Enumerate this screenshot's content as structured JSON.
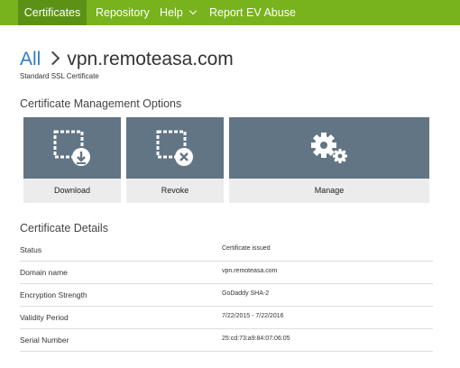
{
  "nav": {
    "items": [
      {
        "label": "Certificates",
        "active": true
      },
      {
        "label": "Repository",
        "active": false
      },
      {
        "label": "Help",
        "active": false,
        "icon": "chevron-down-icon"
      },
      {
        "label": "Report EV Abuse",
        "active": false
      }
    ]
  },
  "colors": {
    "nav_bg": "#78b31d",
    "nav_active_bg": "#5b9216",
    "link": "#2f7fc8",
    "tile_bg": "#627584",
    "tile_label_bg": "#ececec"
  },
  "header": {
    "breadcrumb_root": "All",
    "breadcrumb_separator_icon": "chevron-right-icon",
    "title": "vpn.remoteasa.com",
    "subtitle": "Standard SSL Certificate"
  },
  "options": {
    "title": "Certificate Management Options",
    "tiles": [
      {
        "label": "Download",
        "icon": "certificate-download-icon"
      },
      {
        "label": "Revoke",
        "icon": "certificate-revoke-icon"
      },
      {
        "label": "Manage",
        "icon": "gears-icon"
      }
    ]
  },
  "details": {
    "title": "Certificate Details",
    "rows": [
      {
        "label": "Status",
        "value": "Certificate issued"
      },
      {
        "label": "Domain name",
        "value": "vpn.remoteasa.com"
      },
      {
        "label": "Encryption Strength",
        "value": "GoDaddy SHA-2"
      },
      {
        "label": "Validity Period",
        "value": "7/22/2015 - 7/22/2016"
      },
      {
        "label": "Serial Number",
        "value": "25:cd:73:a9:84:07:06:05"
      }
    ]
  }
}
